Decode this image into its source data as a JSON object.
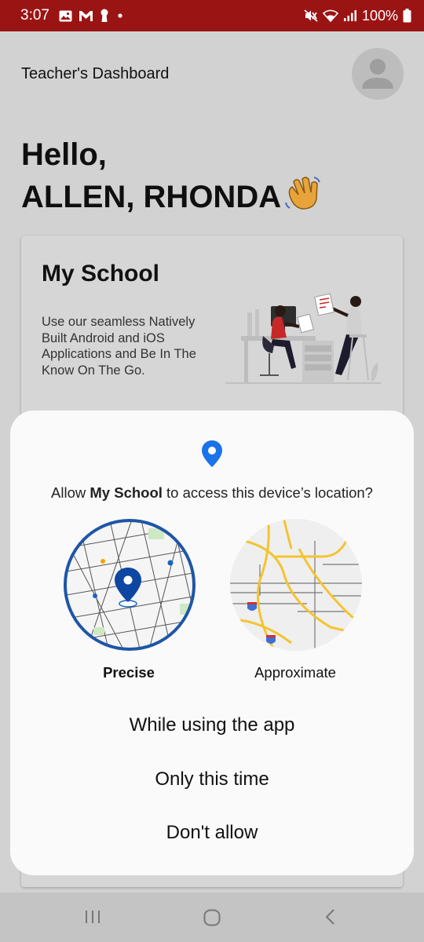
{
  "status_bar": {
    "time": "3:07",
    "left_icons": [
      "gallery-icon",
      "gmail-icon",
      "keyhole-icon",
      "dot-icon"
    ],
    "right_icons": [
      "mute-vibrate-icon",
      "wifi-icon",
      "signal-icon",
      "battery-icon"
    ],
    "battery": "100%"
  },
  "header": {
    "title": "Teacher's Dashboard",
    "avatar_icon": "person-icon"
  },
  "greeting": {
    "line1": "Hello,",
    "name": "ALLEN, RHONDA",
    "emoji_icon": "waving-hand-icon"
  },
  "card": {
    "title": "My School",
    "description": "Use our seamless Natively Built Android and iOS Applications and Be In The Know On The Go."
  },
  "permission_dialog": {
    "question_prefix": "Allow ",
    "app_name": "My School",
    "question_suffix": " to access this device’s location?",
    "precise_label": "Precise",
    "approximate_label": "Approximate",
    "selected": "Precise",
    "buttons": {
      "while_using": "While using the app",
      "only_once": "Only this time",
      "deny": "Don't allow"
    }
  },
  "colors": {
    "status_bar": "#9b1414",
    "accent_blue": "#1565c0",
    "pin_blue": "#1a73e8",
    "map_road_yellow": "#f4c430"
  },
  "nav_bar": {
    "items": [
      "recents-icon",
      "home-icon",
      "back-icon"
    ]
  }
}
